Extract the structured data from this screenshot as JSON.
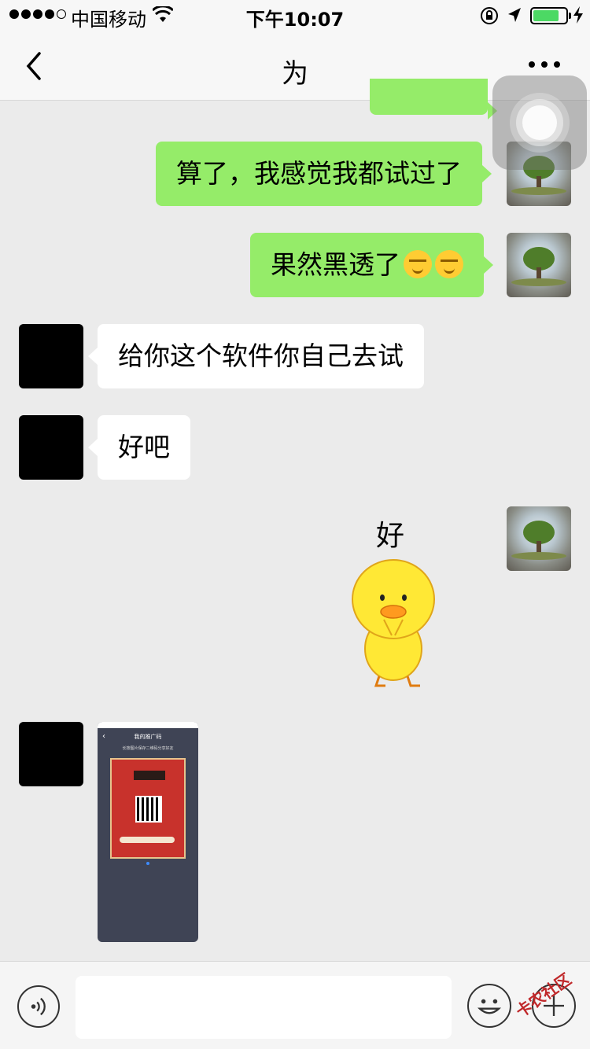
{
  "status_bar": {
    "carrier": "中国移动",
    "time": "下午10:07",
    "battery_level": 0.8,
    "icons": [
      "signal-dots",
      "wifi-icon",
      "orientation-lock-icon",
      "location-icon",
      "battery-icon",
      "charging-icon"
    ]
  },
  "nav": {
    "title": "为",
    "back_icon": "chevron-left-icon",
    "more_icon": "more-dots-icon"
  },
  "messages": [
    {
      "direction": "out",
      "type": "text",
      "text": "算了，我感觉我都试过了"
    },
    {
      "direction": "out",
      "type": "text",
      "text": "果然黑透了",
      "emoji_count": 2
    },
    {
      "direction": "in",
      "type": "text",
      "text": "给你这个软件你自己去试"
    },
    {
      "direction": "in",
      "type": "text",
      "text": "好吧"
    },
    {
      "direction": "out",
      "type": "sticker",
      "text": "好",
      "sticker": "yellow-duck-sticker"
    },
    {
      "direction": "in",
      "type": "image",
      "image": "promo-qr-screenshot"
    }
  ],
  "image_message": {
    "header": "我的推广码",
    "subheader": "长按图片保存二维码分享好友"
  },
  "input_bar": {
    "voice_icon": "voice-icon",
    "text_value": "",
    "emoji_icon": "smiley-icon",
    "plus_icon": "plus-icon"
  },
  "watermark": "卡农社区",
  "colors": {
    "outgoing_bubble": "#95ec69",
    "incoming_bubble": "#ffffff",
    "background": "#ebebeb",
    "battery": "#4cd964"
  }
}
